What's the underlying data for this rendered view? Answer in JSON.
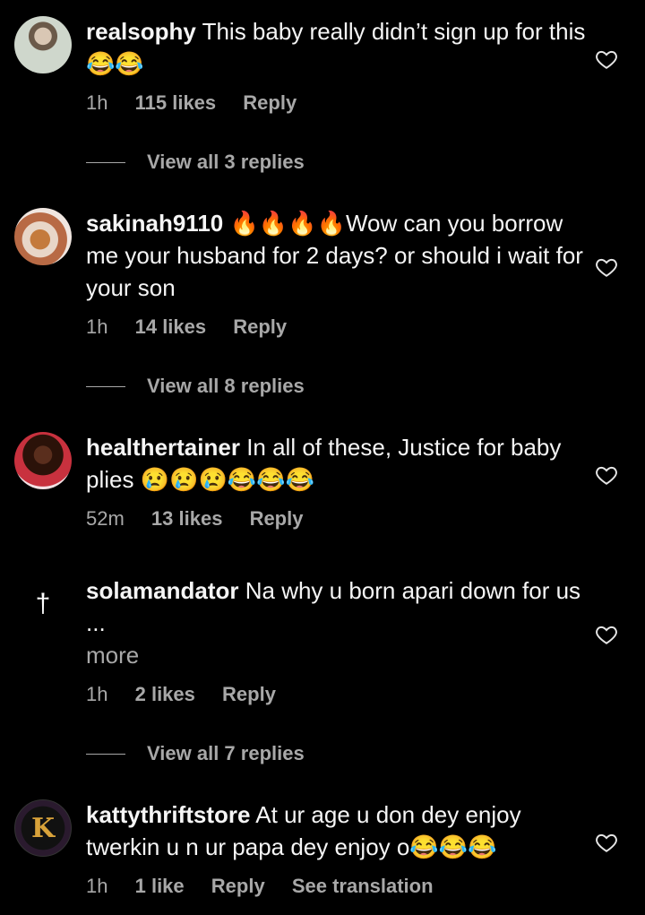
{
  "comments": [
    {
      "username": "realsophy",
      "text": "This baby really didn’t sign up for this😂😂",
      "time": "1h",
      "likes": "115 likes",
      "reply": "Reply",
      "view_replies": "View all 3 replies"
    },
    {
      "username": "sakinah9110",
      "text": "🔥🔥🔥🔥Wow can you borrow me your husband for 2 days? or should i wait for your son",
      "time": "1h",
      "likes": "14 likes",
      "reply": "Reply",
      "view_replies": "View all 8 replies"
    },
    {
      "username": "healthertainer",
      "text": "In all of these, Justice for baby plies 😢😢😢😂😂😂",
      "time": "52m",
      "likes": "13 likes",
      "reply": "Reply"
    },
    {
      "username": "solamandator",
      "text": "Na why u born apari down for us ...",
      "more": "more",
      "time": "1h",
      "likes": "2 likes",
      "reply": "Reply",
      "view_replies": "View all 7 replies",
      "avatar_glyph": "†"
    },
    {
      "username": "kattythriftstore",
      "text": "At ur age u don dey enjoy twerkin u n ur papa dey enjoy o😂😂😂",
      "time": "1h",
      "likes": "1 like",
      "reply": "Reply",
      "translation": "See translation",
      "avatar_glyph": "K"
    }
  ]
}
